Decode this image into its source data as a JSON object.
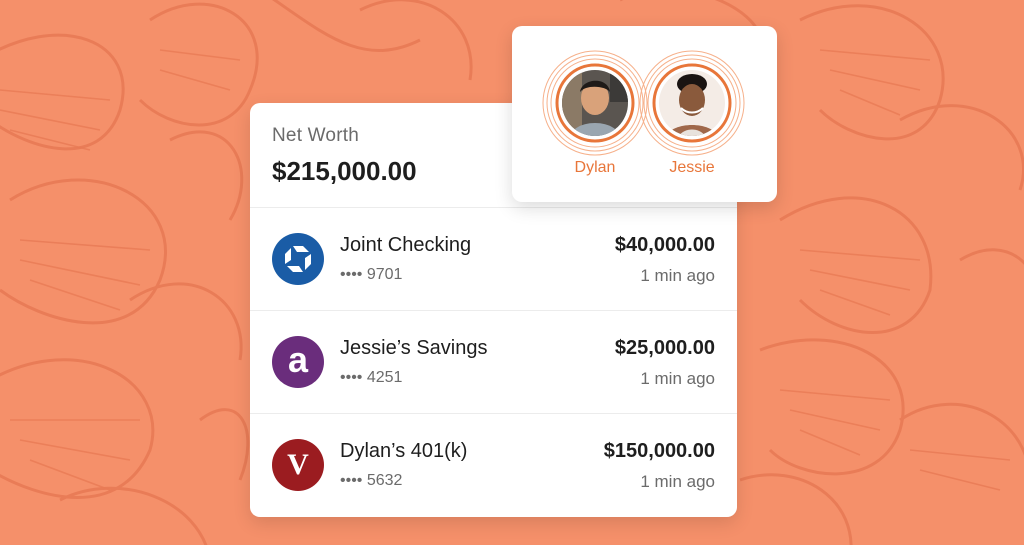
{
  "net_worth": {
    "label": "Net Worth",
    "value": "$215,000.00"
  },
  "accounts": [
    {
      "name": "Joint Checking",
      "mask": "•••• 9701",
      "amount": "$40,000.00",
      "updated": "1 min ago",
      "logo": "chase-logo-icon",
      "color": "#1a5ca6"
    },
    {
      "name": "Jessie’s Savings",
      "mask": "•••• 4251",
      "amount": "$25,000.00",
      "updated": "1 min ago",
      "logo": "ally-logo-icon",
      "logo_text": "a",
      "color": "#6a2d7c"
    },
    {
      "name": "Dylan’s 401(k)",
      "mask": "•••• 5632",
      "amount": "$150,000.00",
      "updated": "1 min ago",
      "logo": "vanguard-logo-icon",
      "logo_text": "V",
      "color": "#9b1c20"
    }
  ],
  "people": [
    {
      "name": "Dylan",
      "avatar": "avatar-man-photo"
    },
    {
      "name": "Jessie",
      "avatar": "avatar-woman-photo"
    }
  ],
  "colors": {
    "background": "#f5906a",
    "pattern": "#e87a55",
    "accent": "#e8763a"
  }
}
